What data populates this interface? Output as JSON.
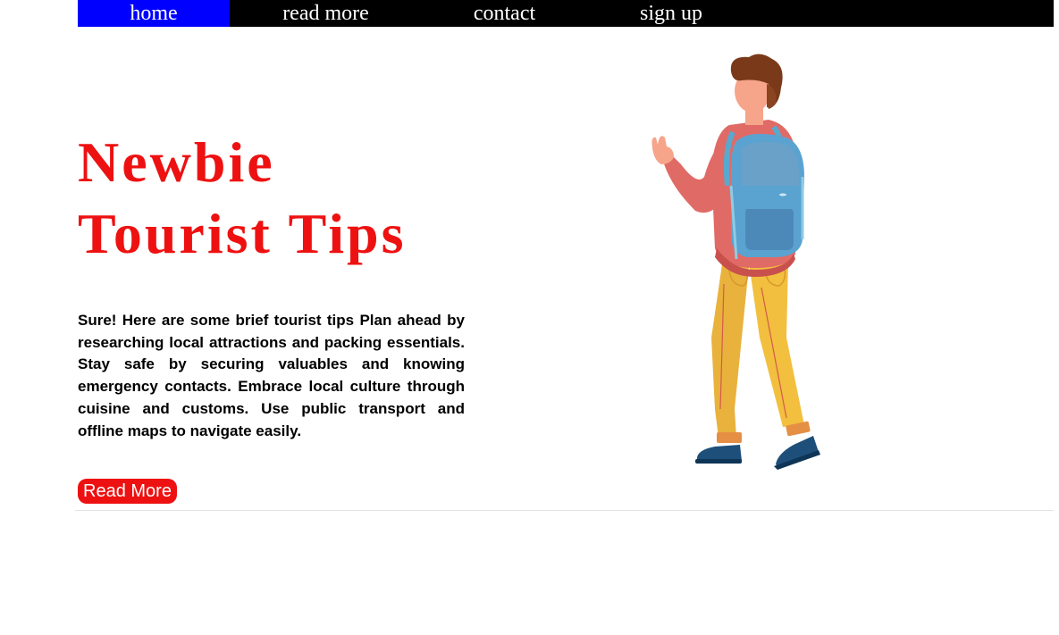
{
  "nav": {
    "items": [
      {
        "label": "home",
        "active": true
      },
      {
        "label": "read more",
        "active": false
      },
      {
        "label": "contact",
        "active": false
      },
      {
        "label": "sign up",
        "active": false
      }
    ]
  },
  "hero": {
    "title_line1": "Newbie",
    "title_line2": "Tourist Tips",
    "body": "Sure! Here are some brief tourist tips Plan ahead by researching local attractions and packing essentials. Stay safe by securing valuables and knowing emergency contacts. Embrace local culture through cuisine and customs. Use public transport and offline maps to navigate easily.",
    "button_label": "Read More",
    "illustration": "tourist-with-backpack-illustration"
  },
  "colors": {
    "nav_background": "#000000",
    "nav_active": "#0000ff",
    "title": "#ee1111",
    "button": "#ee1111"
  }
}
